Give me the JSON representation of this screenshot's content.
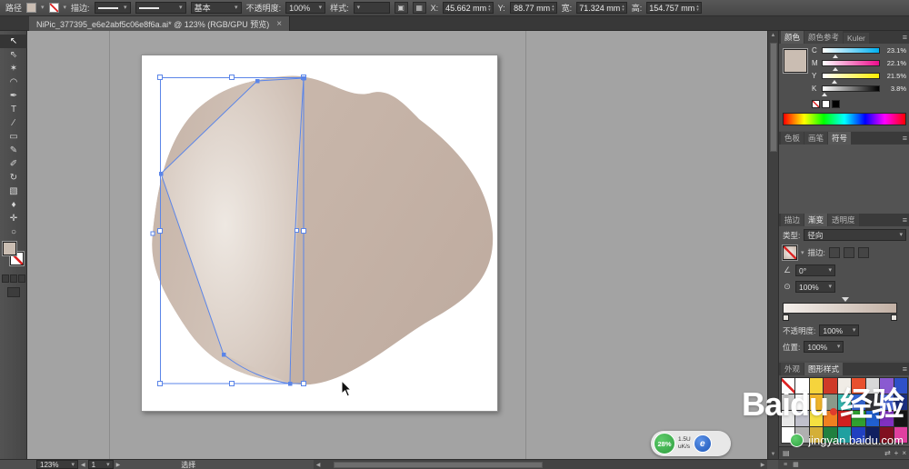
{
  "icons": {
    "caret": "▾",
    "close": "×",
    "menu": "≡",
    "up": "▲",
    "down": "▼",
    "left": "◀",
    "right": "▶",
    "spin_up": "▴",
    "spin_down": "▾",
    "library": "▤",
    "swap": "⇄",
    "new": "+",
    "delete": "×",
    "angle": "∠",
    "ellipse": "⊙",
    "grid": "▦",
    "doc": "▣"
  },
  "control_bar": {
    "context_label": "路径",
    "stroke_label": "描边:",
    "brush_definition": "基本",
    "opacity_label": "不透明度:",
    "opacity_value": "100%",
    "style_label": "样式:",
    "transform_fields": [
      {
        "label": "X:",
        "value": "45.662 mm"
      },
      {
        "label": "Y:",
        "value": "88.77 mm"
      },
      {
        "label": "宽:",
        "value": "71.324 mm"
      },
      {
        "label": "高:",
        "value": "154.757 mm"
      }
    ]
  },
  "tab_bar": {
    "document_title": "NiPic_377395_e6e2abf5c06e8f6a.ai* @ 123% (RGB/GPU 预览)",
    "close_label": "×"
  },
  "toolbar": {
    "tools": [
      {
        "name": "selection-tool",
        "glyph": "↖"
      },
      {
        "name": "direct-selection-tool",
        "glyph": "⇖"
      },
      {
        "name": "magic-wand-tool",
        "glyph": "✶"
      },
      {
        "name": "lasso-tool",
        "glyph": "◠"
      },
      {
        "name": "pen-tool",
        "glyph": "✒"
      },
      {
        "name": "type-tool",
        "glyph": "T"
      },
      {
        "name": "line-tool",
        "glyph": "∕"
      },
      {
        "name": "rectangle-tool",
        "glyph": "▭"
      },
      {
        "name": "pencil-tool",
        "glyph": "✎"
      },
      {
        "name": "paintbrush-tool",
        "glyph": "✐"
      },
      {
        "name": "rotate-tool",
        "glyph": "↻"
      },
      {
        "name": "gradient-tool",
        "glyph": "▧"
      },
      {
        "name": "eyedropper-tool",
        "glyph": "♦"
      },
      {
        "name": "hand-tool",
        "glyph": "✛"
      },
      {
        "name": "zoom-tool",
        "glyph": "○"
      }
    ]
  },
  "canvas": {
    "blob_colors": {
      "base": "#c4b2a6",
      "left": "#cfbfb4",
      "highlight": "#ece6e0"
    },
    "selection_color": "#5b85e8"
  },
  "panels": {
    "color": {
      "tabs": [
        "颜色",
        "颜色参考",
        "Kuler"
      ],
      "active_tab": "颜色",
      "current_swatch": "#cabdb2",
      "channels": [
        {
          "label": "C",
          "value": "23.1%",
          "percent": 23.1,
          "color": "#00b0f0"
        },
        {
          "label": "M",
          "value": "22.1%",
          "percent": 22.1,
          "color": "#ec0c8c"
        },
        {
          "label": "Y",
          "value": "21.5%",
          "percent": 21.5,
          "color": "#ffee00"
        },
        {
          "label": "K",
          "value": "3.8%",
          "percent": 3.8,
          "color": "#000000"
        }
      ]
    },
    "swatches_group": {
      "tabs": [
        "色板",
        "画笔",
        "符号"
      ],
      "active_tab": "符号"
    },
    "gradient": {
      "tabs": [
        "描边",
        "渐变",
        "透明度"
      ],
      "active_tab": "渐变",
      "type_label": "类型:",
      "type_value": "径向",
      "stroke_label": "描边:",
      "angle_value": "0°",
      "aspect_value": "100%",
      "gradient_start": "#f4efeb",
      "gradient_end": "#c2b0a4",
      "opacity_label": "不透明度:",
      "opacity_value": "100%",
      "position_label": "位置:",
      "position_value": "100%"
    },
    "graphic_styles": {
      "tabs": [
        "外观",
        "图形样式"
      ],
      "active_tab": "图形样式",
      "swatches": [
        "none",
        "#ffffff",
        "#f6d43c",
        "#cf3a28",
        "#f0ece6",
        "#e8502e",
        "#d8d8d8",
        "#8a5ad1",
        "#2f51c8",
        "#c8c8c8",
        "#fafafa",
        "#f0b429",
        "#8a9a8a",
        "#35b8b0",
        "#3568d8",
        "#35353a",
        "#4a6ae0",
        "#1a2e80",
        "#e8e8e8",
        "#c0c0cc",
        "#f5e040",
        "#f08020",
        "#d02020",
        "#30a030",
        "#2060d0",
        "#8030c0",
        "#151515",
        "#ffffff",
        "#b0b0b0",
        "#d4af37",
        "#208040",
        "#20a0a0",
        "#2040c0",
        "#102060",
        "#801020",
        "#e040a0"
      ]
    }
  },
  "status_bar": {
    "zoom": "123%",
    "artboard_number": "1",
    "tool_status": "选择"
  },
  "overlays": {
    "network_monitor": {
      "percent": "28%",
      "upload": "1.5U",
      "download": "uK/s"
    },
    "watermark": {
      "brand": "Baidu",
      "brand_suffix": "经验",
      "url": "jingyan.baidu.com"
    }
  }
}
